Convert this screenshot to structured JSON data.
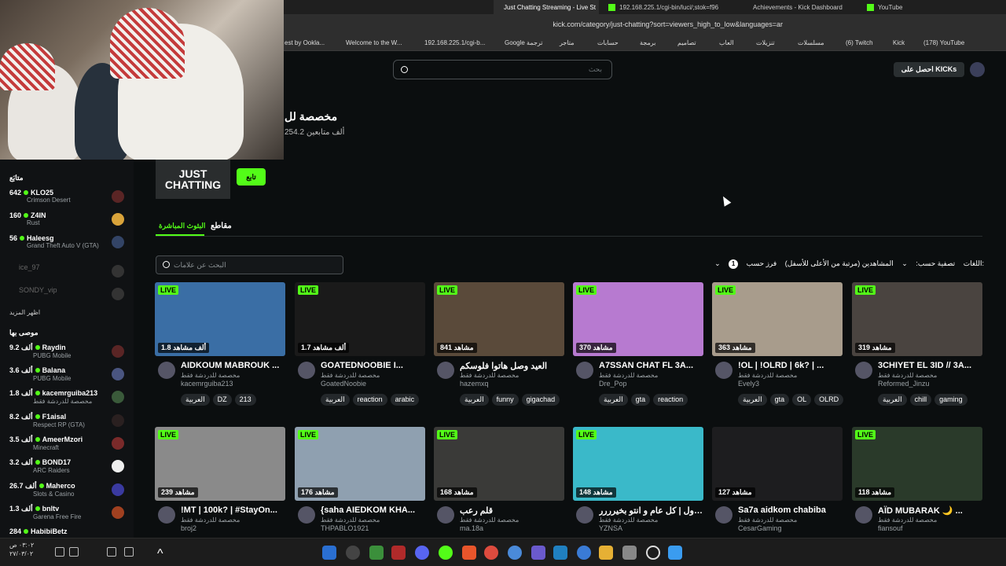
{
  "browser": {
    "tabs": [
      {
        "label": "Just Chatting Streaming - Live St"
      },
      {
        "label": "192.168.225.1/cgi-bin/luci/;stok=f96"
      },
      {
        "label": "Achievements - Kick Dashboard"
      },
      {
        "label": "YouTube"
      }
    ],
    "url": "kick.com/category/just-chatting?sort=viewers_high_to_low&languages=ar",
    "bookmarks": [
      "est by Ookla...",
      "Welcome to the W...",
      "192.168.225.1/cgi-b...",
      "Google ترجمة",
      "متاجر",
      "حسابات",
      "برمجة",
      "تصاميم",
      "العاب",
      "تنزيلات",
      "مسلسلات",
      "(6) Twitch",
      "Kick",
      "(178) YouTube"
    ]
  },
  "header": {
    "search_placeholder": "بحث",
    "kicks_button": "احصل على KICKs"
  },
  "category": {
    "title": "مخصصة لل",
    "followers": "254.2 ألف متابعين",
    "image_text": "JUST CHATTING",
    "follow_label": "تابع",
    "tab_live": "البثوث المباشرة",
    "tab_clips": "مقاطع",
    "tag_search_placeholder": "البحث عن علامات",
    "filter_languages": "اللغات",
    "filter_languages_count": "1",
    "filter_by": "تصفية حسب:",
    "sort_value": "المشاهدين (مرتبة من الأعلى للأسفل)",
    "sort_by": "فرز حسب:"
  },
  "sidebar": {
    "following_heading": "متابَع",
    "following": [
      {
        "count": "642",
        "name": "KLO25",
        "game": "Crimson Desert"
      },
      {
        "count": "160",
        "name": "Z4IN",
        "game": "Rust"
      },
      {
        "count": "56",
        "name": "Haleesg",
        "game": "Grand Theft Auto V (GTA)"
      },
      {
        "count": "",
        "name": "ice_97",
        "game": ""
      },
      {
        "count": "",
        "name": "SONDY_vip",
        "game": ""
      }
    ],
    "show_more": "اظهر المزيد",
    "recommended_heading": "موصى بها",
    "recommended": [
      {
        "count": "9.2 ألف",
        "name": "Raydin",
        "game": "PUBG Mobile"
      },
      {
        "count": "3.6 ألف",
        "name": "Balana",
        "game": "PUBG Mobile"
      },
      {
        "count": "1.8 ألف",
        "name": "kacemrguiba213",
        "game": "مخصصة للدردشة فقط"
      },
      {
        "count": "8.2 ألف",
        "name": "F1aisal",
        "game": "Respect RP (GTA)"
      },
      {
        "count": "3.5 ألف",
        "name": "AmeerMzori",
        "game": "Minecraft"
      },
      {
        "count": "3.2 ألف",
        "name": "BOND17",
        "game": "ARC Raiders"
      },
      {
        "count": "26.7 ألف",
        "name": "Maherco",
        "game": "Slots & Casino"
      },
      {
        "count": "1.3 ألف",
        "name": "bnltv",
        "game": "Garena Free Fire"
      },
      {
        "count": "284",
        "name": "HabibiBetz",
        "game": ""
      }
    ]
  },
  "streams": [
    {
      "live": "LIVE",
      "viewers": "1.8 ألف مشاهد",
      "title": "AIDKOUM MABROUK ...",
      "category": "مخصصة للدردشة فقط",
      "channel": "kacemrguiba213",
      "tags": [
        "العربية",
        "DZ",
        "213"
      ],
      "color": "#3a6ea5"
    },
    {
      "live": "LIVE",
      "viewers": "1.7 ألف مشاهد",
      "title": "GOATEDNOOBIE I...",
      "category": "مخصصة للدردشة فقط",
      "channel": "GoatedNoobie",
      "tags": [
        "العربية",
        "reaction",
        "arabic"
      ],
      "color": "#1a1a1a"
    },
    {
      "live": "LIVE",
      "viewers": "841 مشاهد",
      "title": "العيد وصل هاتوا فلوسكم",
      "category": "مخصصة للدردشة فقط",
      "channel": "hazemxq",
      "tags": [
        "العربية",
        "funny",
        "gigachad"
      ],
      "color": "#5a4a3a"
    },
    {
      "live": "LIVE",
      "viewers": "370 مشاهد",
      "title": "A7SSAN CHAT FL 3A...",
      "category": "مخصصة للدردشة فقط",
      "channel": "Dre_Pop",
      "tags": [
        "العربية",
        "gta",
        "reaction"
      ],
      "color": "#b77ad0"
    },
    {
      "live": "LIVE",
      "viewers": "363 مشاهد",
      "title": "!OL | !OLRD | 6k? | ...",
      "category": "مخصصة للدردشة فقط",
      "channel": "Evely3",
      "tags": [
        "العربية",
        "gta",
        "OL",
        "OLRD"
      ],
      "color": "#a89c8c"
    },
    {
      "live": "LIVE",
      "viewers": "319 مشاهد",
      "title": "3CHIYET EL 3ID // 3A...",
      "category": "مخصصة للدردشة فقط",
      "channel": "Reformed_Jinzu",
      "tags": [
        "العربية",
        "chill",
        "gaming"
      ],
      "color": "#4a4440"
    },
    {
      "live": "LIVE",
      "viewers": "239 مشاهد",
      "title": "!MT | 100k? | #StayOn...",
      "category": "مخصصة للدردشة فقط",
      "channel": "broj2",
      "tags": [],
      "color": "#8a8a8a"
    },
    {
      "live": "LIVE",
      "viewers": "176 مشاهد",
      "title": "{saha AIEDKOM KHA...",
      "category": "مخصصة للدردشة فقط",
      "channel": "THPABLO1921",
      "tags": [],
      "color": "#8fa0b0"
    },
    {
      "live": "LIVE",
      "viewers": "168 مشاهد",
      "title": "قلم رعب",
      "category": "مخصصة للدردشة فقط",
      "channel": "ma.18a",
      "tags": [],
      "color": "#3a3a38"
    },
    {
      "live": "LIVE",
      "viewers": "148 مشاهد",
      "title": "بثون اول | كل عام و انتو بخيرررر",
      "category": "مخصصة للدردشة فقط",
      "channel": "YZNSA",
      "tags": [],
      "color": "#3ab9c9"
    },
    {
      "live": "",
      "viewers": "127 مشاهد",
      "title": "Sa7a aidkom chabiba",
      "category": "مخصصة للدردشة فقط",
      "channel": "CesarGaming",
      "tags": [],
      "color": "#1d1d1f"
    },
    {
      "live": "LIVE",
      "viewers": "118 مشاهد",
      "title": "AÏD MUBARAK 🌙 ...",
      "category": "مخصصة للدردشة فقط",
      "channel": "fiansouf",
      "tags": [],
      "color": "#2a3a2a"
    }
  ],
  "taskbar": {
    "time": "٠٣:٠٢ ص",
    "date": "٢٧/٠٣/٠٢"
  }
}
